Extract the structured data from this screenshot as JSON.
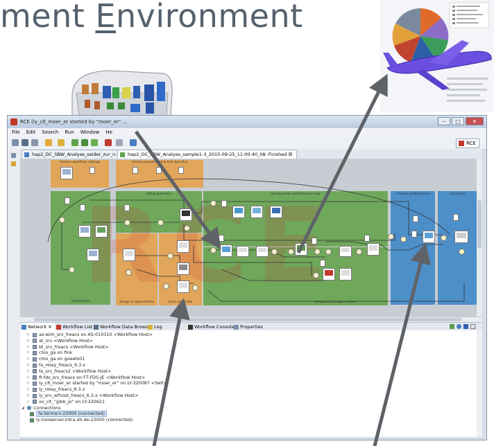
{
  "slide": {
    "title_before": "ment ",
    "title_underlined": "E",
    "title_after": "nvironment"
  },
  "window": {
    "title": "RCE (ly_clt_moer_er started by \"moer_er\" ...",
    "menu": [
      "File",
      "Edit",
      "Search",
      "Run",
      "Window",
      "He"
    ],
    "rce_button": "RCE",
    "editor_tabs": [
      "hap2_DC_SBW_Analyse_seider_zur_n.wf",
      "hap2_DC_SBW_Analyse_sample1-3_2015-09-25_11:00:40_08: Finished"
    ]
  },
  "workflow": {
    "groups": [
      {
        "label": "mission workflow settings",
        "color": "#e2a65a"
      },
      {
        "label": "mission parameters & tool specifics",
        "color": "#e2a65a"
      },
      {
        "label": "initialization",
        "color": "#6fa85a"
      },
      {
        "label": "initial geometry",
        "color": "#6fa85a"
      },
      {
        "label": "aerodynamic performance map",
        "color": "#6fa85a"
      },
      {
        "label": "mission performance",
        "color": "#4d8fc9"
      },
      {
        "label": "synthesis",
        "color": "#4d8fc9"
      },
      {
        "label": "design of experiments",
        "color": "#e2a65a"
      },
      {
        "label": "mass integrator",
        "color": "#e2a65a"
      },
      {
        "label": "wing and fuselage masses",
        "color": "#6fa85a"
      }
    ],
    "watermark": "RCE"
  },
  "views": {
    "tabs": [
      "Network",
      "Workflow List",
      "Workflow Data Browser",
      "Log",
      "Workflow Console",
      "Properties"
    ]
  },
  "network": {
    "hosts": [
      "as-wim_srv_freacs on AS-010310 <Workflow Host>",
      "at_srv <Workflow Host>",
      "bt_srv_freacs <Workflow Host>",
      "chio_ga on fink",
      "chio_ga on goeets01",
      "fa_relay_freacs_6.3.x",
      "fa_srv_freacs2 <Workflow Host>",
      "ft-fds_srv_freacs on FT-FDS-JE <Workflow Host>",
      "ly_clt_moer_er started by \"moer_er\" on LY-320087 <Self>",
      "ly_relay_freacs_6.3.x",
      "ly_srv_wfhost_freacs_6.3.x <Workflow Host>",
      "xx_clt_\"gibb_jo\" on LY-320621"
    ],
    "connections_label": "Connections",
    "connections": [
      "fa-termsrv:23000 (connected)",
      "ly-toolserver.intra.dlr.de:23000 (connected)"
    ]
  },
  "colors": {
    "accent_red": "#c0392b",
    "orange_group": "#e2a65a",
    "green_group": "#6fa85a",
    "blue_group": "#4d8fc9",
    "arrow": "#5f6368"
  }
}
